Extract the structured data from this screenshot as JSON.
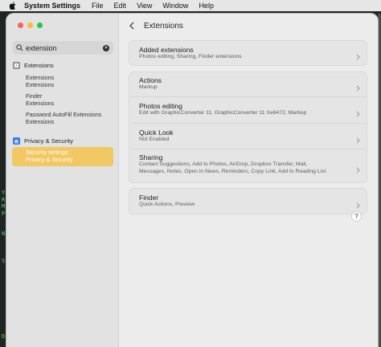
{
  "menubar": {
    "app_name": "System Settings",
    "items": [
      "File",
      "Edit",
      "View",
      "Window",
      "Help"
    ]
  },
  "sidebar": {
    "search": {
      "value": "extension",
      "clear_icon": "clear-icon"
    },
    "section_extensions": {
      "label": "Extensions",
      "icon": "puzzle-icon",
      "icon_color": "#8e8e93"
    },
    "results": [
      {
        "line1": "Extensions",
        "line2": "Extensions"
      },
      {
        "line1": "Finder",
        "line2": "Extensions"
      },
      {
        "line1": "Password AutoFill Extensions",
        "line2": "Extensions"
      }
    ],
    "section_privacy": {
      "label": "Privacy & Security",
      "icon": "hand-icon",
      "icon_color": "#3478f6"
    },
    "selected": {
      "line1": "Security settings",
      "line2": "Privacy & Security",
      "color": "#f1c863"
    }
  },
  "main": {
    "title": "Extensions",
    "cards": [
      {
        "rows": [
          {
            "label": "Added extensions",
            "desc": [
              "Photos editing, Sharing, Finder extensions"
            ]
          }
        ]
      },
      {
        "rows": [
          {
            "label": "Actions",
            "desc": [
              "Markup"
            ]
          },
          {
            "label": "Photos editing",
            "desc": [
              "Edit with GraphicConverter 11, GraphicConverter 11 Xe8472, Markup"
            ]
          },
          {
            "label": "Quick Look",
            "desc": [
              "Not Enabled"
            ]
          },
          {
            "label": "Sharing",
            "desc": [
              "Contact Suggestions, Add to Photos, AirDrop, Dropbox Transfer, Mail,",
              "Messages, Notes, Open in News, Reminders, Copy Link, Add to Reading List"
            ]
          }
        ]
      },
      {
        "rows": [
          {
            "label": "Finder",
            "desc": [
              "Quick Actions, Preview"
            ]
          }
        ]
      }
    ],
    "help_label": "?"
  },
  "desktop": {
    "terminal_lines": [
      "Y",
      "R",
      "M",
      "P",
      "",
      "",
      "N",
      "",
      "",
      "",
      "S",
      "",
      "",
      "",
      "",
      "",
      "",
      "",
      "",
      "",
      "",
      "D"
    ]
  }
}
